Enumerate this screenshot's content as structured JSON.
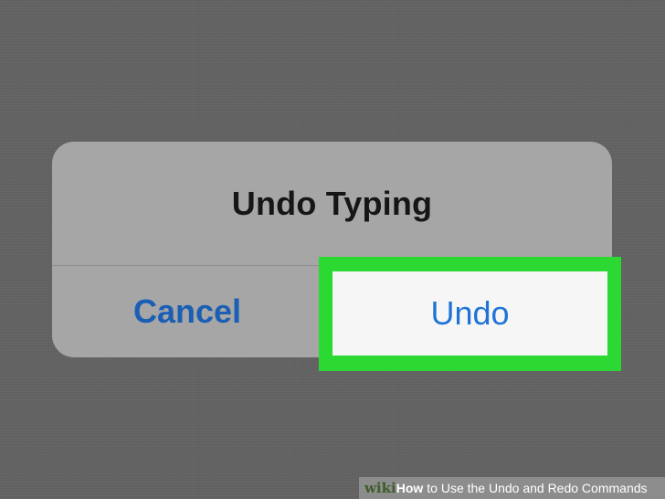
{
  "dialog": {
    "title": "Undo Typing",
    "cancel_label": "Cancel",
    "undo_label": "Undo"
  },
  "colors": {
    "background": "#626262",
    "dialog_background": "#a6a6a6",
    "highlight": "#2bd932",
    "link_blue": "#1f73d6",
    "cancel_blue": "#1a5fb4"
  },
  "watermark": {
    "wiki": "wiki",
    "how": "How",
    "rest": "to Use the Undo and Redo Commands"
  }
}
